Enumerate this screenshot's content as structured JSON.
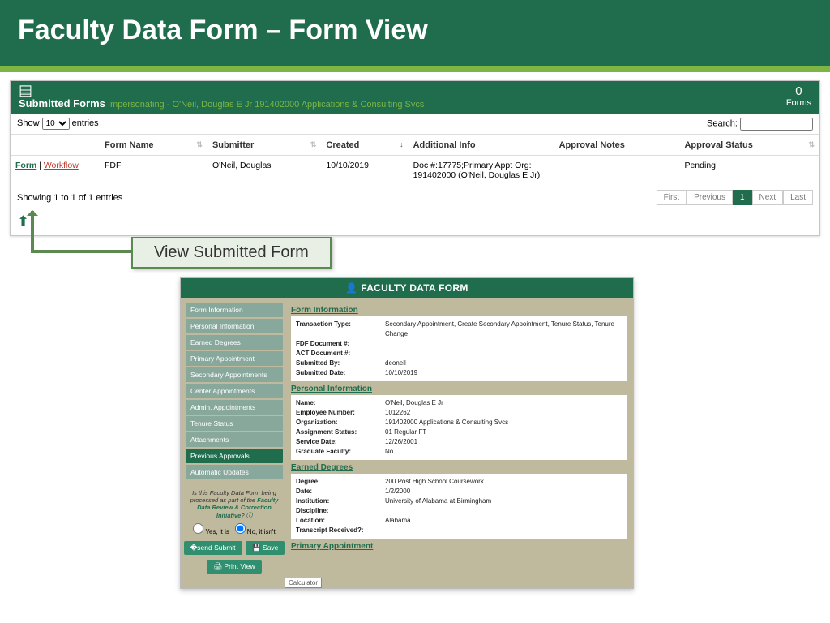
{
  "banner": {
    "title": "Faculty Data Form – Form View"
  },
  "panel1": {
    "title": "Submitted Forms",
    "subtitle": "Impersonating - O'Neil, Douglas E Jr 191402000 Applications & Consulting Svcs",
    "count_n": "0",
    "count_lbl": "Forms",
    "show_lbl": "Show",
    "entries_lbl": "entries",
    "show_value": "10",
    "search_lbl": "Search:",
    "cols": [
      "",
      "Form Name",
      "Submitter",
      "Created",
      "Additional Info",
      "Approval Notes",
      "Approval Status"
    ],
    "row": {
      "link_form": "Form",
      "link_wf": "Workflow",
      "form_name": "FDF",
      "submitter": "O'Neil, Douglas",
      "created": "10/10/2019",
      "additional": "Doc #:17775;Primary Appt Org: 191402000 (O'Neil, Douglas E Jr)",
      "notes": "",
      "status": "Pending"
    },
    "showing": "Showing 1 to 1 of 1 entries",
    "pager": [
      "First",
      "Previous",
      "1",
      "Next",
      "Last"
    ]
  },
  "callout": "View Submitted Form",
  "panel2": {
    "title": "FACULTY DATA FORM",
    "nav": [
      "Form Information",
      "Personal Information",
      "Earned Degrees",
      "Primary Appointment",
      "Secondary Appointments",
      "Center Appointments",
      "Admin. Appointments",
      "Tenure Status",
      "Attachments",
      "Previous Approvals",
      "Automatic Updates"
    ],
    "nav_active_index": 9,
    "helper_a": "Is this Faculty Data Form being processed as part of the ",
    "helper_b": "Faculty Data Review & Correction Initiative",
    "helper_c": "?",
    "radio_yes": "Yes, it is",
    "radio_no": "No, it isn't",
    "btn_submit": "Submit",
    "btn_save": "Save",
    "btn_print": "Print View",
    "calc": "Calculator",
    "sections": {
      "form_info": {
        "title": "Form Information",
        "rows": [
          [
            "Transaction Type:",
            "Secondary Appointment, Create Secondary Appointment, Tenure Status, Tenure Change"
          ],
          [
            "FDF Document #:",
            ""
          ],
          [
            "ACT Document #:",
            ""
          ],
          [
            "Submitted By:",
            "deoneil"
          ],
          [
            "Submitted Date:",
            "10/10/2019"
          ]
        ]
      },
      "personal": {
        "title": "Personal Information",
        "rows": [
          [
            "Name:",
            "O'Neil, Douglas E Jr"
          ],
          [
            "Employee Number:",
            "1012262"
          ],
          [
            "Organization:",
            "191402000 Applications & Consulting Svcs"
          ],
          [
            "Assignment Status:",
            "01 Regular FT"
          ],
          [
            "Service Date:",
            "12/26/2001"
          ],
          [
            "Graduate Faculty:",
            "No"
          ]
        ]
      },
      "degrees": {
        "title": "Earned Degrees",
        "rows": [
          [
            "Degree:",
            "200 Post High School Coursework"
          ],
          [
            "Date:",
            "1/2/2000"
          ],
          [
            "Institution:",
            "University of Alabama at Birmingham"
          ],
          [
            "Discipline:",
            ""
          ],
          [
            "Location:",
            "Alabama"
          ],
          [
            "Transcript Received?:",
            ""
          ]
        ]
      },
      "primary": {
        "title": "Primary Appointment"
      }
    }
  }
}
